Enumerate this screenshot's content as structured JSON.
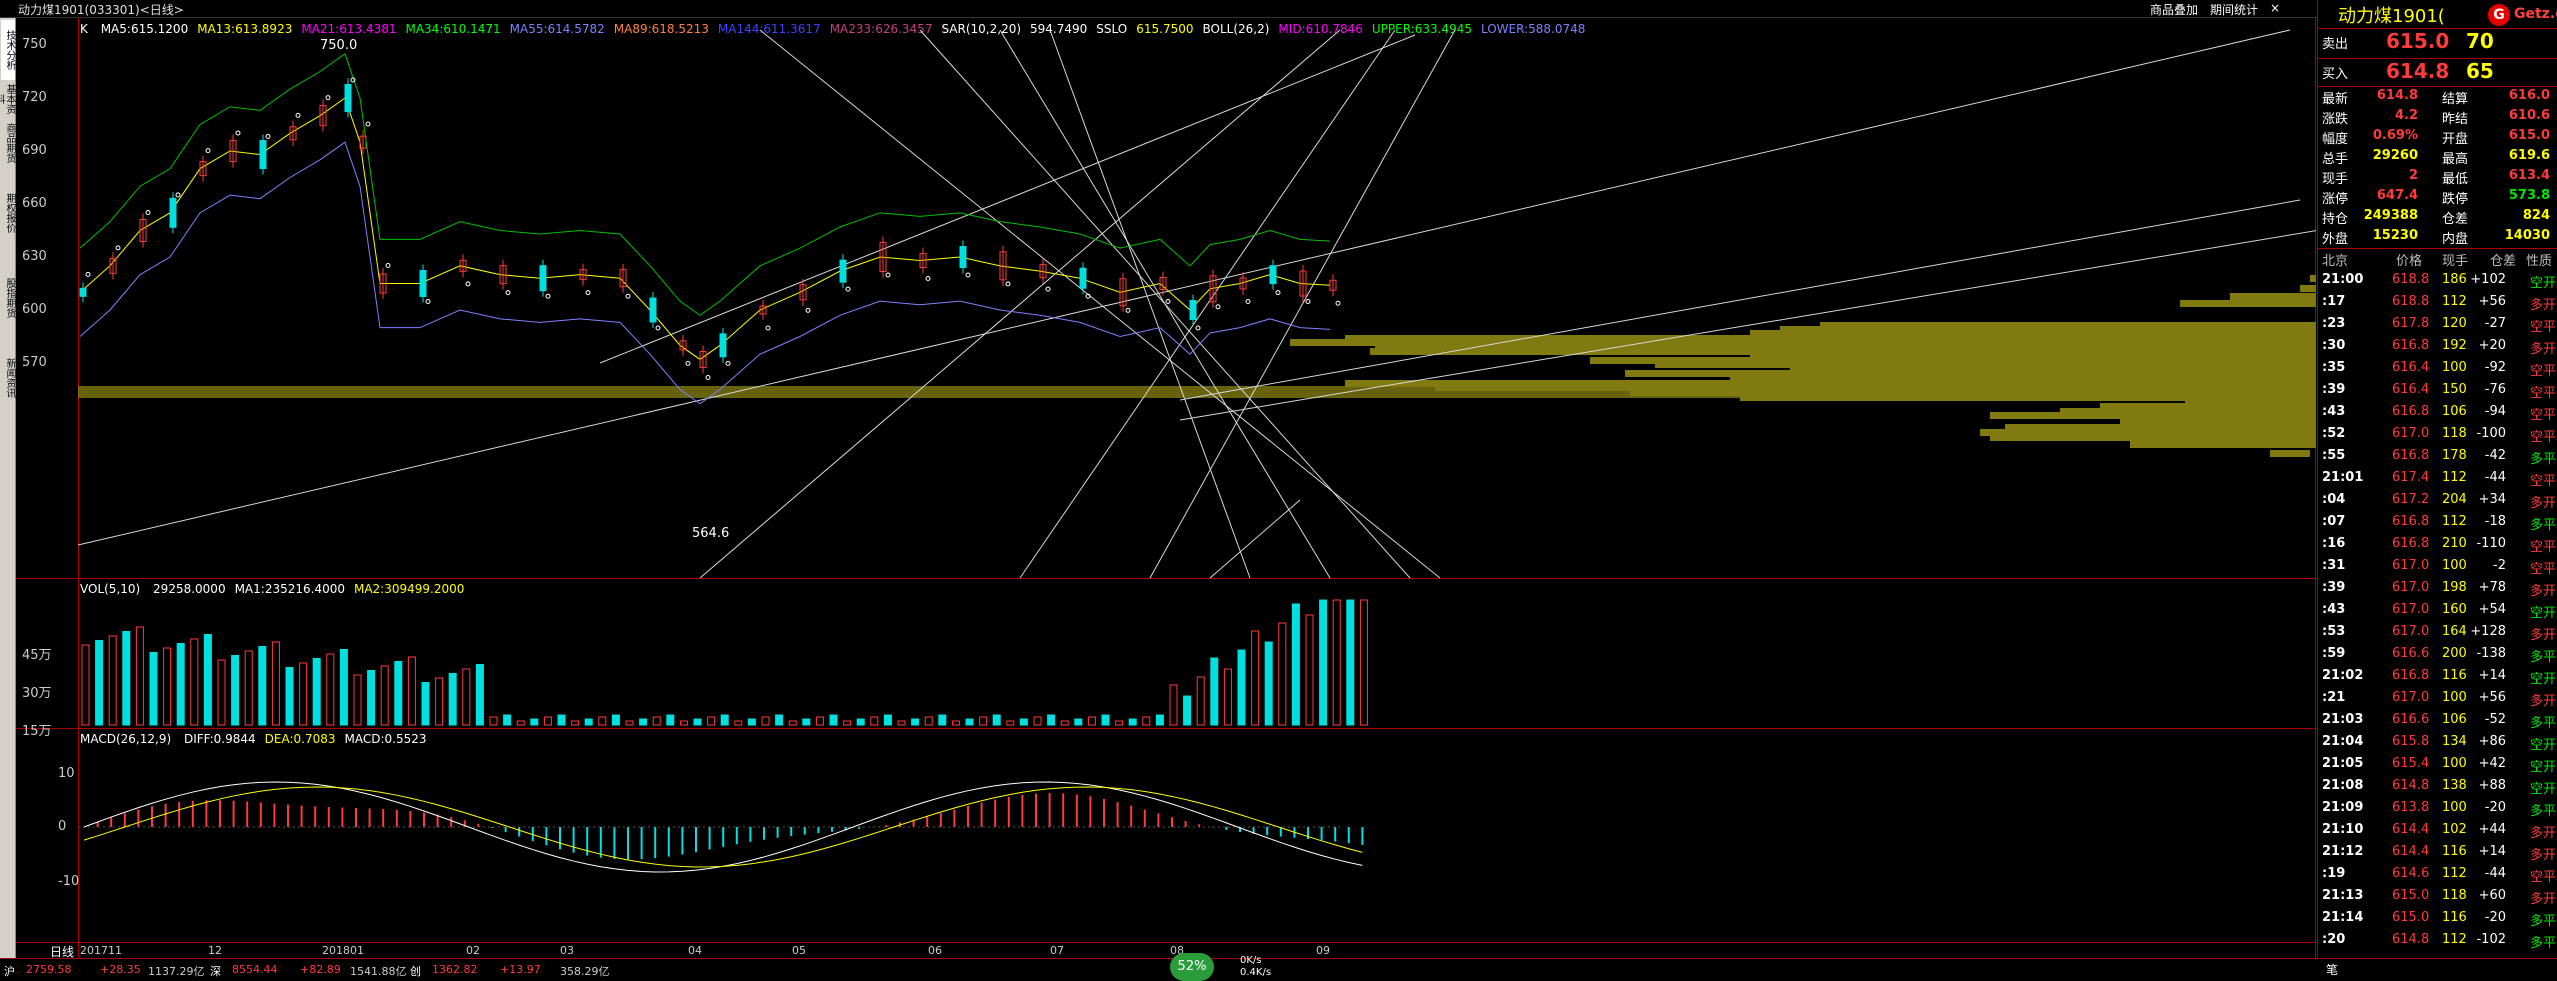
{
  "window": {
    "title": "动力煤1901(033301)<日线>",
    "menu_right": [
      "商品叠加",
      "期间统计",
      "×"
    ],
    "contract_title": "动力煤1901(",
    "brand": "Getz.com"
  },
  "left_tabs": [
    "技术分析",
    "基本资料",
    "商品期货",
    "期权报价",
    "股指期货",
    "新闻资讯"
  ],
  "main_chart": {
    "label": "K",
    "indicators": [
      {
        "text": "MA5:615.1200",
        "color": "#ffffff"
      },
      {
        "text": "MA13:613.8923",
        "color": "#ffff00"
      },
      {
        "text": "MA21:613.4381",
        "color": "#ff00ff"
      },
      {
        "text": "MA34:610.1471",
        "color": "#00ff00"
      },
      {
        "text": "MA55:614.5782",
        "color": "#8080ff"
      },
      {
        "text": "MA89:618.5213",
        "color": "#ff8040"
      },
      {
        "text": "MA144:611.3617",
        "color": "#4040ff"
      },
      {
        "text": "MA233:626.3457",
        "color": "#c04080"
      },
      {
        "text": "SAR(10,2,20)",
        "color": "#ffffff"
      },
      {
        "text": "594.7490",
        "color": "#ffffff"
      },
      {
        "text": "SSLO",
        "color": "#ffffff"
      },
      {
        "text": "615.7500",
        "color": "#ffff00"
      },
      {
        "text": "BOLL(26,2)",
        "color": "#ffffff"
      },
      {
        "text": "MID:610.7846",
        "color": "#ff00ff"
      },
      {
        "text": "UPPER:633.4945",
        "color": "#00ff00"
      },
      {
        "text": "LOWER:588.0748",
        "color": "#8080ff"
      }
    ],
    "y_ticks": [
      "750",
      "720",
      "690",
      "660",
      "630",
      "600",
      "570"
    ],
    "high_label": "750.0",
    "low_label": "564.6"
  },
  "vol_chart": {
    "label": "VOL(5,10)",
    "indicators": [
      {
        "text": "29258.0000",
        "color": "#ffffff"
      },
      {
        "text": "MA1:235216.4000",
        "color": "#ffffff"
      },
      {
        "text": "MA2:309499.2000",
        "color": "#ffff00"
      }
    ],
    "y_ticks": [
      "45万",
      "30万",
      "15万"
    ]
  },
  "macd_chart": {
    "label": "MACD(26,12,9)",
    "indicators": [
      {
        "text": "DIFF:0.9844",
        "color": "#ffffff"
      },
      {
        "text": "DEA:0.7083",
        "color": "#ffff00"
      },
      {
        "text": "MACD:0.5523",
        "color": "#ffffff"
      }
    ],
    "y_ticks": [
      "10",
      "0",
      "-10"
    ]
  },
  "x_axis": {
    "period_label": "日线",
    "ticks": [
      "201711",
      "12",
      "201801",
      "02",
      "03",
      "04",
      "05",
      "06",
      "07",
      "08",
      "09"
    ]
  },
  "quote_panel": {
    "ask": {
      "label": "卖出",
      "price": "615.0",
      "vol": "70"
    },
    "bid": {
      "label": "买入",
      "price": "614.8",
      "vol": "65"
    },
    "stats": [
      [
        "最新",
        "614.8",
        "结算",
        "616.0"
      ],
      [
        "涨跌",
        "4.2",
        "昨结",
        "610.6"
      ],
      [
        "幅度",
        "0.69%",
        "开盘",
        "615.0"
      ],
      [
        "总手",
        "29260",
        "最高",
        "619.6"
      ],
      [
        "现手",
        "2",
        "最低",
        "613.4"
      ],
      [
        "涨停",
        "647.4",
        "跌停",
        "573.8"
      ],
      [
        "持仓",
        "249388",
        "仓差",
        "824"
      ],
      [
        "外盘",
        "15230",
        "内盘",
        "14030"
      ]
    ],
    "ticks_header": [
      "北京",
      "价格",
      "现手",
      "仓差",
      "性质"
    ],
    "ticks": [
      [
        "21:00",
        "618.8",
        "186",
        "+102",
        "空开"
      ],
      [
        ":17",
        "618.8",
        "112",
        "+56",
        "多开"
      ],
      [
        ":23",
        "617.8",
        "120",
        "-27",
        "空平"
      ],
      [
        ":30",
        "616.8",
        "192",
        "+20",
        "多开"
      ],
      [
        ":35",
        "616.4",
        "100",
        "-92",
        "空平"
      ],
      [
        ":39",
        "616.4",
        "150",
        "-76",
        "空平"
      ],
      [
        ":43",
        "616.8",
        "106",
        "-94",
        "空平"
      ],
      [
        ":52",
        "617.0",
        "118",
        "-100",
        "空平"
      ],
      [
        ":55",
        "616.8",
        "178",
        "-42",
        "多平"
      ],
      [
        "21:01",
        "617.4",
        "112",
        "-44",
        "空平"
      ],
      [
        ":04",
        "617.2",
        "204",
        "+34",
        "多开"
      ],
      [
        ":07",
        "616.8",
        "112",
        "-18",
        "多平"
      ],
      [
        ":16",
        "616.8",
        "210",
        "-110",
        "空平"
      ],
      [
        ":31",
        "617.0",
        "100",
        "-2",
        "空平"
      ],
      [
        ":39",
        "617.0",
        "198",
        "+78",
        "多开"
      ],
      [
        ":43",
        "617.0",
        "160",
        "+54",
        "空开"
      ],
      [
        ":53",
        "617.0",
        "164",
        "+128",
        "多开"
      ],
      [
        ":59",
        "616.6",
        "200",
        "-138",
        "多平"
      ],
      [
        "21:02",
        "616.8",
        "116",
        "+14",
        "空开"
      ],
      [
        ":21",
        "617.0",
        "100",
        "+56",
        "多开"
      ],
      [
        "21:03",
        "616.6",
        "106",
        "-52",
        "多平"
      ],
      [
        "21:04",
        "615.8",
        "134",
        "+86",
        "空开"
      ],
      [
        "21:05",
        "615.4",
        "100",
        "+42",
        "空开"
      ],
      [
        "21:08",
        "614.8",
        "138",
        "+88",
        "空开"
      ],
      [
        "21:09",
        "613.8",
        "100",
        "-20",
        "多平"
      ],
      [
        "21:10",
        "614.4",
        "102",
        "+44",
        "多开"
      ],
      [
        "21:12",
        "614.4",
        "116",
        "+14",
        "多开"
      ],
      [
        ":19",
        "614.6",
        "112",
        "-44",
        "空平"
      ],
      [
        "21:13",
        "615.0",
        "118",
        "+60",
        "多开"
      ],
      [
        "21:14",
        "615.0",
        "116",
        "-20",
        "多平"
      ],
      [
        ":20",
        "614.8",
        "112",
        "-102",
        "多平"
      ]
    ]
  },
  "status": {
    "progress_pct": "52%",
    "net_up": "0K/s",
    "net_down": "0.4K/s",
    "tab": "笔",
    "left_items": [
      "沪",
      "2759.58",
      "+28.35",
      "1137.29亿",
      "深",
      "8554.44",
      "+82.89",
      "1541.88亿",
      "创",
      "1362.82",
      "+13.97",
      "358.29亿"
    ]
  }
}
